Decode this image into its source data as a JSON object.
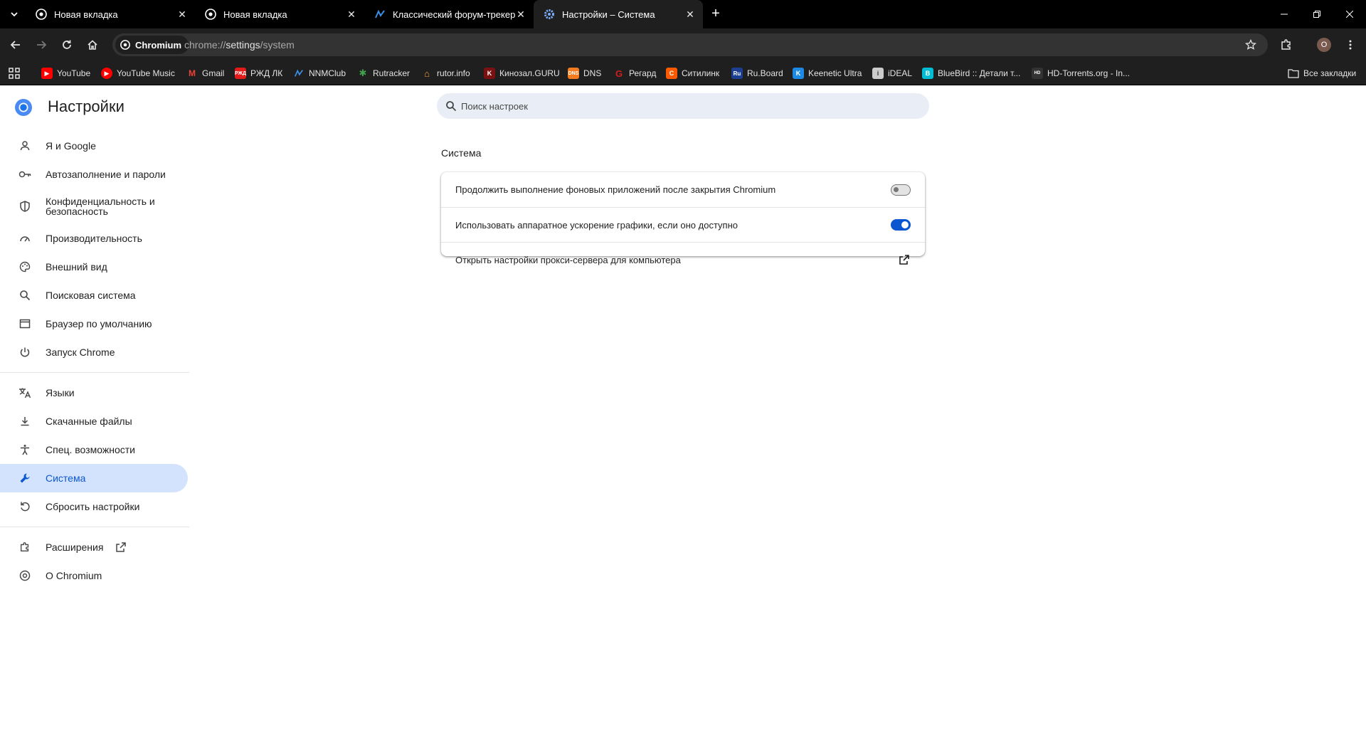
{
  "tabs": [
    {
      "title": "Новая вкладка",
      "icon": "chromium-icon"
    },
    {
      "title": "Новая вкладка",
      "icon": "chromium-icon"
    },
    {
      "title": "Классический форум-трекер :",
      "icon": "nnmclub-icon"
    },
    {
      "title": "Настройки – Система",
      "icon": "gear-icon"
    }
  ],
  "toolbar": {
    "chip_label": "Chromium",
    "url_scheme": "chrome://",
    "url_host": "settings",
    "url_path": "/system",
    "avatar_letter": "O"
  },
  "bookmarks": [
    {
      "label": "YouTube",
      "icon": "youtube-icon",
      "color": "#ff0000"
    },
    {
      "label": "YouTube Music",
      "icon": "youtube-music-icon",
      "color": "#ff0000"
    },
    {
      "label": "Gmail",
      "icon": "gmail-icon",
      "color": "#ea4335"
    },
    {
      "label": "РЖД ЛК",
      "icon": "rzd-icon",
      "color": "#e21a1a"
    },
    {
      "label": "NNMClub",
      "icon": "nnmclub-icon",
      "color": "#2a7de1"
    },
    {
      "label": "Rutracker",
      "icon": "rutracker-icon",
      "color": "#3fa34d"
    },
    {
      "label": "rutor.info",
      "icon": "rutor-icon",
      "color": "#f0a030"
    },
    {
      "label": "Кинозал.GURU",
      "icon": "kinozal-icon",
      "color": "#b22222"
    },
    {
      "label": "DNS",
      "icon": "dns-icon",
      "color": "#f47b20"
    },
    {
      "label": "Регард",
      "icon": "regard-icon",
      "color": "#d11f1f"
    },
    {
      "label": "Ситилинк",
      "icon": "citilink-icon",
      "color": "#ff5a00"
    },
    {
      "label": "Ru.Board",
      "icon": "ruboard-icon",
      "color": "#1c3f94"
    },
    {
      "label": "Keenetic Ultra",
      "icon": "keenetic-icon",
      "color": "#1e88e5"
    },
    {
      "label": "iDEAL",
      "icon": "ideal-icon",
      "color": "#cccccc"
    },
    {
      "label": "BlueBird :: Детали т...",
      "icon": "bluebird-icon",
      "color": "#00bcd4"
    },
    {
      "label": "HD-Torrents.org - In...",
      "icon": "hdtorrents-icon",
      "color": "#333333"
    }
  ],
  "bookmarks_all": "Все закладки",
  "settings": {
    "title": "Настройки",
    "search_placeholder": "Поиск настроек",
    "nav_group1": [
      {
        "label": "Я и Google",
        "icon": "person-icon"
      },
      {
        "label": "Автозаполнение и пароли",
        "icon": "key-icon"
      },
      {
        "label": "Конфиденциальность и безопасность",
        "icon": "shield-icon"
      },
      {
        "label": "Производительность",
        "icon": "speedometer-icon"
      },
      {
        "label": "Внешний вид",
        "icon": "palette-icon"
      },
      {
        "label": "Поисковая система",
        "icon": "search-icon"
      },
      {
        "label": "Браузер по умолчанию",
        "icon": "browser-window-icon"
      },
      {
        "label": "Запуск Chrome",
        "icon": "power-icon"
      }
    ],
    "nav_group2": [
      {
        "label": "Языки",
        "icon": "translate-icon"
      },
      {
        "label": "Скачанные файлы",
        "icon": "download-icon"
      },
      {
        "label": "Спец. возможности",
        "icon": "accessibility-icon"
      },
      {
        "label": "Система",
        "icon": "wrench-icon"
      },
      {
        "label": "Сбросить настройки",
        "icon": "reset-icon"
      }
    ],
    "nav_group3": [
      {
        "label": "Расширения",
        "icon": "puzzle-icon"
      },
      {
        "label": "О Chromium",
        "icon": "chromium-icon"
      }
    ],
    "active_nav": "Система",
    "section_title": "Система",
    "rows": [
      {
        "label": "Продолжить выполнение фоновых приложений после закрытия Chromium",
        "control": "toggle",
        "enabled": false
      },
      {
        "label": "Использовать аппаратное ускорение графики, если оно доступно",
        "control": "toggle",
        "enabled": true
      },
      {
        "label": "Открыть настройки прокси-сервера для компьютера",
        "control": "external-link"
      }
    ]
  },
  "colors": {
    "accent": "#0b57d0",
    "active_nav_bg": "#d3e3fd",
    "search_bg": "#e9eef6",
    "chrome_dark": "#1f1f1f"
  }
}
